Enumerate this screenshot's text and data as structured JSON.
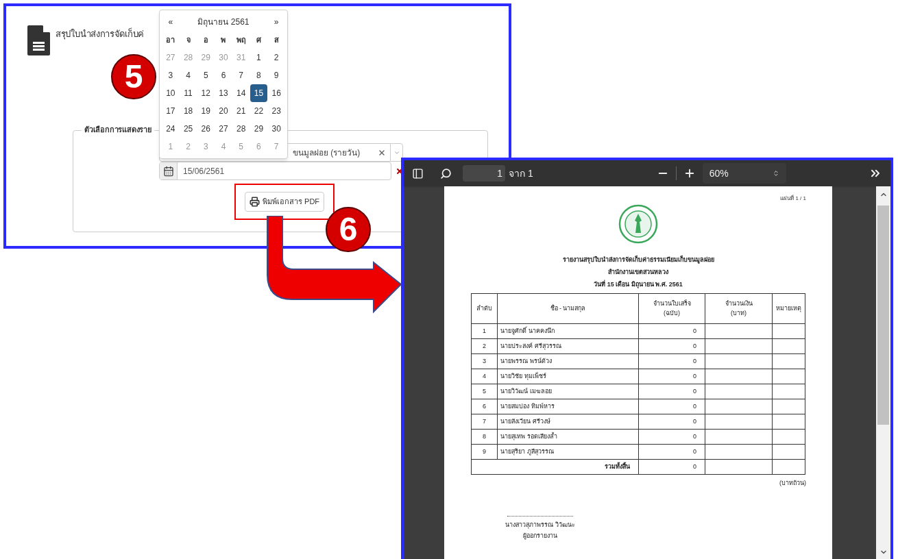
{
  "form_panel": {
    "title": "สรุปใบนำส่งการจัดเก็บค่",
    "legend": "ตัวเลือกการแสดงราย",
    "report_select": {
      "value": "ขนมูลฝอย (รายวัน)"
    },
    "date_field": {
      "value": "15/06/2561"
    },
    "print_button": "พิมพ์เอกสาร PDF"
  },
  "calendar": {
    "prev": "«",
    "title": "มิถุนายน 2561",
    "next": "»",
    "weekdays": [
      "อา",
      "จ",
      "อ",
      "พ",
      "พฤ",
      "ศ",
      "ส"
    ],
    "days": [
      {
        "label": "27",
        "muted": true,
        "selected": false
      },
      {
        "label": "28",
        "muted": true,
        "selected": false
      },
      {
        "label": "29",
        "muted": true,
        "selected": false
      },
      {
        "label": "30",
        "muted": true,
        "selected": false
      },
      {
        "label": "31",
        "muted": true,
        "selected": false
      },
      {
        "label": "1",
        "muted": false,
        "selected": false
      },
      {
        "label": "2",
        "muted": false,
        "selected": false
      },
      {
        "label": "3",
        "muted": false,
        "selected": false
      },
      {
        "label": "4",
        "muted": false,
        "selected": false
      },
      {
        "label": "5",
        "muted": false,
        "selected": false
      },
      {
        "label": "6",
        "muted": false,
        "selected": false
      },
      {
        "label": "7",
        "muted": false,
        "selected": false
      },
      {
        "label": "8",
        "muted": false,
        "selected": false
      },
      {
        "label": "9",
        "muted": false,
        "selected": false
      },
      {
        "label": "10",
        "muted": false,
        "selected": false
      },
      {
        "label": "11",
        "muted": false,
        "selected": false
      },
      {
        "label": "12",
        "muted": false,
        "selected": false
      },
      {
        "label": "13",
        "muted": false,
        "selected": false
      },
      {
        "label": "14",
        "muted": false,
        "selected": false
      },
      {
        "label": "15",
        "muted": false,
        "selected": true
      },
      {
        "label": "16",
        "muted": false,
        "selected": false
      },
      {
        "label": "17",
        "muted": false,
        "selected": false
      },
      {
        "label": "18",
        "muted": false,
        "selected": false
      },
      {
        "label": "19",
        "muted": false,
        "selected": false
      },
      {
        "label": "20",
        "muted": false,
        "selected": false
      },
      {
        "label": "21",
        "muted": false,
        "selected": false
      },
      {
        "label": "22",
        "muted": false,
        "selected": false
      },
      {
        "label": "23",
        "muted": false,
        "selected": false
      },
      {
        "label": "24",
        "muted": false,
        "selected": false
      },
      {
        "label": "25",
        "muted": false,
        "selected": false
      },
      {
        "label": "26",
        "muted": false,
        "selected": false
      },
      {
        "label": "27",
        "muted": false,
        "selected": false
      },
      {
        "label": "28",
        "muted": false,
        "selected": false
      },
      {
        "label": "29",
        "muted": false,
        "selected": false
      },
      {
        "label": "30",
        "muted": false,
        "selected": false
      },
      {
        "label": "1",
        "muted": true,
        "selected": false
      },
      {
        "label": "2",
        "muted": true,
        "selected": false
      },
      {
        "label": "3",
        "muted": true,
        "selected": false
      },
      {
        "label": "4",
        "muted": true,
        "selected": false
      },
      {
        "label": "5",
        "muted": true,
        "selected": false
      },
      {
        "label": "6",
        "muted": true,
        "selected": false
      },
      {
        "label": "7",
        "muted": true,
        "selected": false
      }
    ]
  },
  "callouts": [
    {
      "label": "5"
    },
    {
      "label": "6"
    }
  ],
  "pdf_viewer": {
    "toolbar": {
      "page": "1",
      "page_total": "จาก 1",
      "zoom": "60%"
    },
    "document": {
      "sheet": "แผ่นที่ 1 / 1",
      "heading": [
        "รายงานสรุปใบนำส่งการจัดเก็บค่าธรรมเนียมเก็บขนมูลฝอย",
        "สำนักงานเขตสวนหลวง",
        "วันที่ 15 เดือน มิถุนายน พ.ศ. 2561"
      ],
      "columns": [
        {
          "label": "ลำดับ"
        },
        {
          "label": "ชื่อ - นามสกุล"
        },
        {
          "label": "จำนวนใบเสร็จ",
          "unit": "(ฉบับ)"
        },
        {
          "label": "จำนวนเงิน",
          "unit": "(บาท)"
        },
        {
          "label": "หมายเหตุ"
        }
      ],
      "rows": [
        {
          "no": "1",
          "name": "นายจูศักดิ์ นาคคงนึก",
          "receipts": "0"
        },
        {
          "no": "2",
          "name": "นายประสงค์ ศรีสุวรรณ",
          "receipts": "0"
        },
        {
          "no": "3",
          "name": "นายพรรณ พรน์ด้วง",
          "receipts": "0"
        },
        {
          "no": "4",
          "name": "นายวิชัย ทุมเพ็ชร์",
          "receipts": "0"
        },
        {
          "no": "5",
          "name": "นายวิวัฒน์ เมฆลอย",
          "receipts": "0"
        },
        {
          "no": "6",
          "name": "นายสมปอง ทิมพ์หาร",
          "receipts": "0"
        },
        {
          "no": "7",
          "name": "นายสังเวียน ศรีวงษ์",
          "receipts": "0"
        },
        {
          "no": "8",
          "name": "นายสุเทพ รอดเสียงล้ำ",
          "receipts": "0"
        },
        {
          "no": "9",
          "name": "นายสุริยา ภูสีสุวรรณ",
          "receipts": "0"
        }
      ],
      "total": {
        "label": "รวมทั้งสิ้น",
        "receipts": "0"
      },
      "currency_note": "(บาทถ้วน)",
      "signature": {
        "name": "นางสาวสุภาพรรณ วิวัฒนะ",
        "role": "ผู้ออกรายงาน"
      }
    }
  }
}
